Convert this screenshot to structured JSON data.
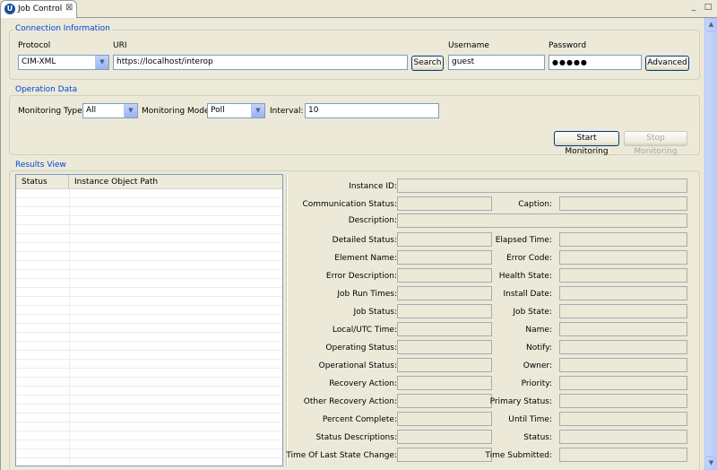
{
  "tab": {
    "title": "Job Control",
    "close": "⊠"
  },
  "connection": {
    "section_title": "Connection Information",
    "protocol_label": "Protocol",
    "protocol_value": "CIM-XML",
    "uri_label": "URI",
    "uri_value": "https://localhost/interop",
    "search_label": "Search",
    "username_label": "Username",
    "username_value": "guest",
    "password_label": "Password",
    "password_value": "●●●●●",
    "advanced_label": "Advanced"
  },
  "operation": {
    "section_title": "Operation Data",
    "type_label": "Monitoring Type:",
    "type_value": "All",
    "mode_label": "Monitoring Mode:",
    "mode_value": "Poll",
    "interval_label": "Interval:",
    "interval_value": "10",
    "start_label": "Start Monitoring",
    "stop_label": "Stop Monitoring"
  },
  "results": {
    "section_title": "Results View",
    "columns": [
      "Status",
      "Instance Object Path"
    ]
  },
  "details": {
    "instance_id": "Instance ID:",
    "communication_status": "Communication Status:",
    "caption": "Caption:",
    "description": "Description:",
    "detailed_status": "Detailed Status:",
    "elapsed_time": "Elapsed Time:",
    "element_name": "Element Name:",
    "error_code": "Error Code:",
    "error_description": "Error Description:",
    "health_state": "Health State:",
    "job_run_times": "Job Run Times:",
    "install_date": "Install Date:",
    "job_status": "Job Status:",
    "job_state": "Job State:",
    "local_utc_time": "Local/UTC Time:",
    "name": "Name:",
    "operating_status": "Operating Status:",
    "notify": "Notify:",
    "operational_status": "Operational Status:",
    "owner": "Owner:",
    "recovery_action": "Recovery Action:",
    "priority": "Priority:",
    "other_recovery_action": "Other Recovery Action:",
    "primary_status": "Primary Status:",
    "percent_complete": "Percent Complete:",
    "until_time": "Until Time:",
    "status_descriptions": "Status Descriptions:",
    "status": "Status:",
    "time_of_last_state_change": "Time Of Last State Change:",
    "time_submitted": "Time Submitted:"
  }
}
